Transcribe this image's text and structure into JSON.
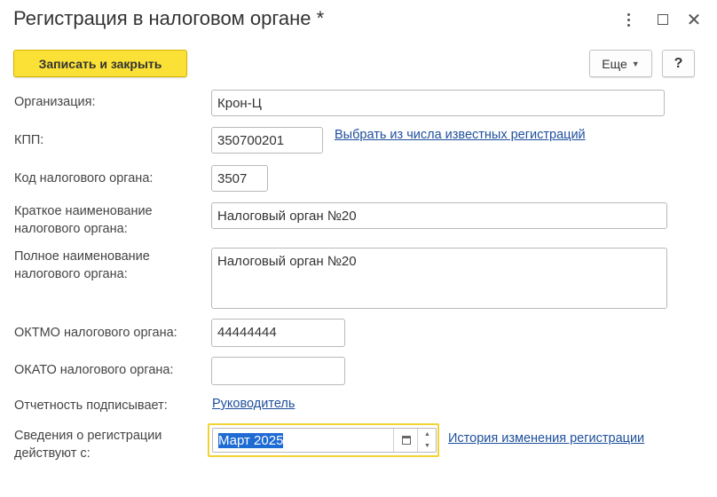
{
  "window": {
    "title": "Регистрация в налоговом органе *"
  },
  "toolbar": {
    "save_close_label": "Записать и закрыть",
    "more_label": "Еще",
    "help_label": "?"
  },
  "form": {
    "organization": {
      "label": "Организация:",
      "value": "Крон-Ц"
    },
    "kpp": {
      "label": "КПП:",
      "value": "350700201",
      "link": "Выбрать из числа известных регистраций"
    },
    "tax_code": {
      "label": "Код налогового органа:",
      "value": "3507"
    },
    "short_name": {
      "label_line1": "Краткое наименование",
      "label_line2": "налогового органа:",
      "value": "Налоговый орган №20"
    },
    "full_name": {
      "label_line1": "Полное наименование",
      "label_line2": "налогового органа:",
      "value": "Налоговый орган №20"
    },
    "oktmo": {
      "label": "ОКТМО налогового органа:",
      "value": "44444444"
    },
    "okato": {
      "label": "ОКАТО налогового органа:",
      "value": ""
    },
    "signer": {
      "label": "Отчетность подписывает:",
      "link": "Руководитель"
    },
    "registration": {
      "label_line1": "Сведения о регистрации",
      "label_line2": "действуют с:",
      "value": "Март 2025",
      "link": "История изменения регистрации"
    }
  },
  "icons": {
    "kebab": "kebab-menu-icon",
    "maximize": "maximize-icon",
    "close": "close-icon",
    "calendar": "calendar-icon",
    "spin_up": "chevron-up-icon",
    "spin_down": "chevron-down-icon"
  },
  "colors": {
    "primary_button": "#fbe136",
    "link": "#1e4f9c",
    "focus_border": "#f3d233",
    "selection": "#1e6bd4"
  }
}
